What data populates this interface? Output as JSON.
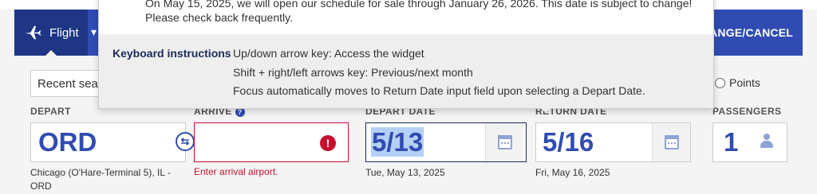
{
  "nav": {
    "flight_label": "Flight",
    "flight_icon": "airplane-icon",
    "change_cancel_label": "CHANGE/CANCEL",
    "bar_color": "#304cb2",
    "active_tab_color": "#1f3685"
  },
  "tooltip": {
    "message": "On May 15, 2025, we will open our schedule for sale through January 26, 2026. This date is subject to change! Please check back frequently.",
    "keyboard_title": "Keyboard instructions",
    "lines": [
      "Up/down arrow key: Access the widget",
      "Shift + right/left arrows key: Previous/next month",
      "Focus automatically moves to Return Date input field upon selecting a Depart Date."
    ]
  },
  "form": {
    "recent_searches": "Recent searches",
    "points_label": "Points",
    "depart": {
      "label": "DEPART",
      "value": "ORD",
      "sub": "Chicago (O'Hare-Terminal 5), IL - ORD"
    },
    "arrive": {
      "label": "ARRIVE",
      "help": "?",
      "value": "",
      "error": "Enter arrival airport."
    },
    "depart_date": {
      "label": "DEPART DATE",
      "value": "5/13",
      "sub": "Tue, May 13, 2025"
    },
    "return_date": {
      "label": "RETURN DATE",
      "value": "5/16",
      "sub": "Fri, May 16, 2025"
    },
    "passengers": {
      "label": "PASSENGERS",
      "value": "1"
    }
  },
  "colors": {
    "accent": "#304cb2",
    "error": "#c8102e",
    "selection": "#b4d0f5"
  }
}
